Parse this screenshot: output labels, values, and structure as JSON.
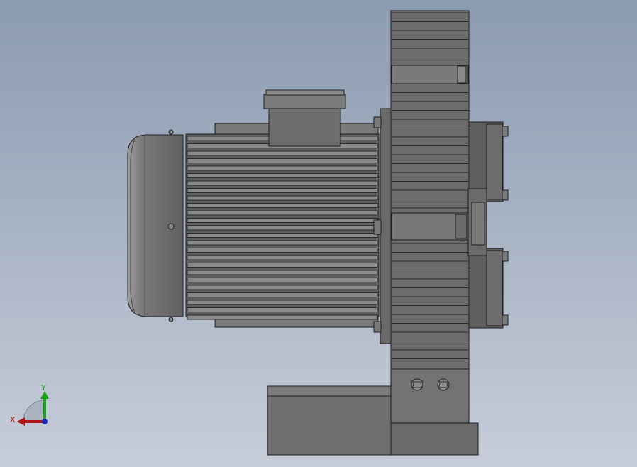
{
  "viewport": {
    "background_top": "#8b9bb1",
    "background_bottom": "#c7cdd9",
    "model_colors": {
      "base": "#6f6f6f",
      "light": "#8a8a8a",
      "dark": "#4a4a4a",
      "edge": "#1e1e1e"
    }
  },
  "triad": {
    "x_label": "X",
    "y_label": "Y",
    "x_color": "#b01515",
    "y_color": "#19a019",
    "origin_color": "#2030c0"
  }
}
